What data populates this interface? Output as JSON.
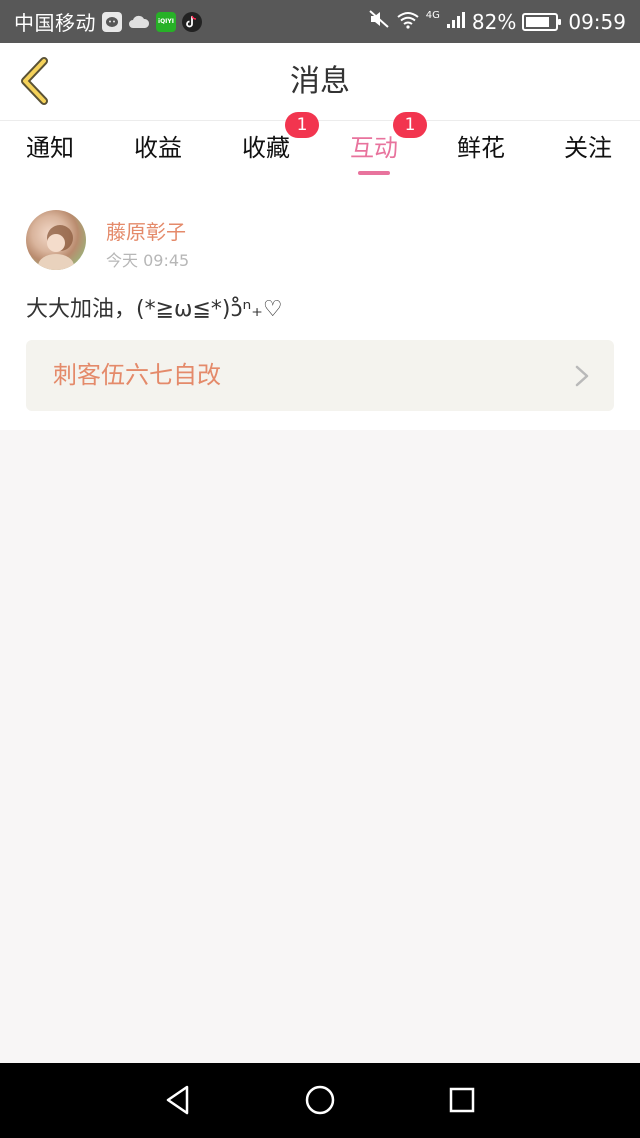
{
  "status_bar": {
    "carrier": "中国移动",
    "apps": [
      {
        "icon": "wechat-icon"
      },
      {
        "icon": "cloud-icon"
      },
      {
        "icon": "iqiyi-icon",
        "label": "iQIYI"
      },
      {
        "icon": "tiktok-icon"
      }
    ],
    "network": "4G",
    "battery": "82%",
    "battery_level": 0.82,
    "time": "09:59"
  },
  "header": {
    "title": "消息",
    "back_icon": "back-chevron-icon"
  },
  "tabs": [
    {
      "label": "通知",
      "badge": "",
      "active": false
    },
    {
      "label": "收益",
      "badge": "",
      "active": false
    },
    {
      "label": "收藏",
      "badge": "1",
      "active": false
    },
    {
      "label": "互动",
      "badge": "1",
      "active": true
    },
    {
      "label": "鲜花",
      "badge": "",
      "active": false
    },
    {
      "label": "关注",
      "badge": "",
      "active": false
    }
  ],
  "message": {
    "sender": "藤原彰子",
    "time": "今天 09:45",
    "text": "大大加油，(*≧ω≦*)ɔ̊̊ⁿ₊♡",
    "article_title": "刺客伍六七自改"
  },
  "colors": {
    "accent": "#e8739d",
    "badge": "#f2354f",
    "name": "#e48a6a",
    "status_bar": "#585858"
  }
}
